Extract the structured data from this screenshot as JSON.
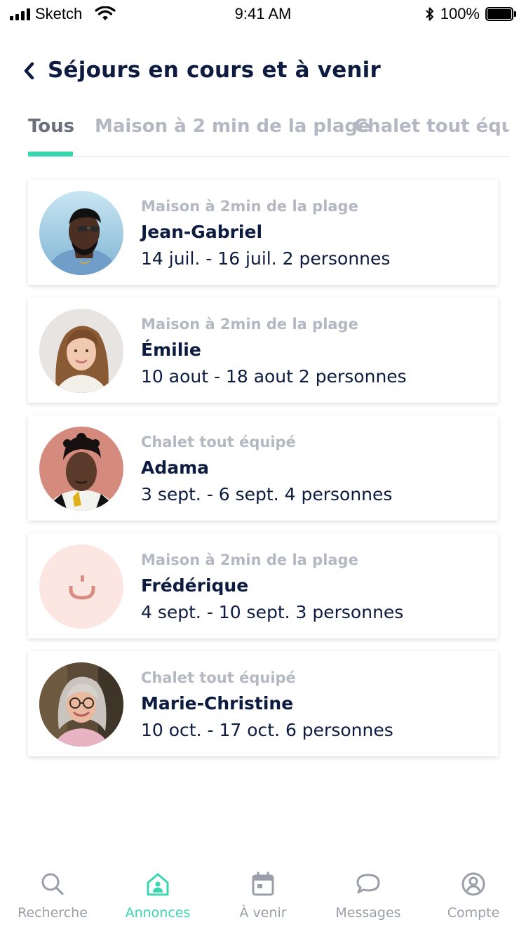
{
  "status_bar": {
    "carrier": "Sketch",
    "time": "9:41 AM",
    "battery": "100%",
    "signal_icon": "signal-bars-icon",
    "wifi_icon": "wifi-icon",
    "bluetooth_icon": "bluetooth-icon",
    "battery_icon": "battery-icon"
  },
  "header": {
    "back_icon": "chevron-left-icon",
    "title": "Séjours en cours et à venir"
  },
  "tabs": {
    "active_index": 0,
    "items": [
      {
        "label": "Tous"
      },
      {
        "label": "Maison à 2 min de la plage"
      },
      {
        "label": "Chalet tout équipé"
      }
    ]
  },
  "bookings": [
    {
      "listing": "Maison à 2min de la plage",
      "guest": "Jean-Gabriel",
      "dates": "14 juil. - 16 juil. 2 personnes"
    },
    {
      "listing": "Maison à 2min de la plage",
      "guest": "Émilie",
      "dates": "10 aout - 18 aout 2 personnes"
    },
    {
      "listing": "Chalet tout équipé",
      "guest": "Adama",
      "dates": "3 sept. - 6 sept. 4 personnes"
    },
    {
      "listing": "Maison à 2min de la plage",
      "guest": "Frédérique",
      "dates": "4 sept. - 10 sept. 3 personnes"
    },
    {
      "listing": "Chalet tout équipé",
      "guest": "Marie-Christine",
      "dates": "10 oct. - 17 oct. 6 personnes"
    }
  ],
  "bottom_nav": {
    "active_index": 1,
    "items": [
      {
        "label": "Recherche",
        "icon": "search-icon"
      },
      {
        "label": "Annonces",
        "icon": "home-icon"
      },
      {
        "label": "À venir",
        "icon": "calendar-icon"
      },
      {
        "label": "Messages",
        "icon": "chat-bubble-icon"
      },
      {
        "label": "Compte",
        "icon": "user-circle-icon"
      }
    ]
  },
  "colors": {
    "accent": "#3ad6b0",
    "title": "#0c1b3f",
    "muted": "#b4b8c2",
    "nav_inactive": "#9a9ea8"
  }
}
